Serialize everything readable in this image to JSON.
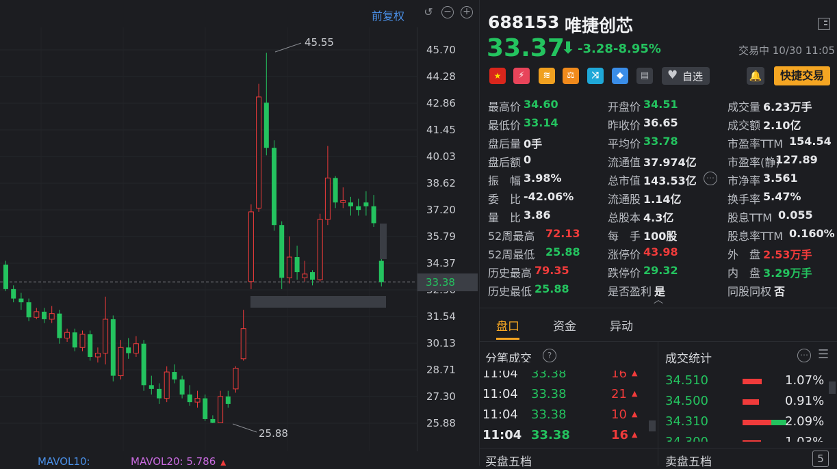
{
  "chart": {
    "adjust_label": "前复权",
    "price_axis": [
      "45.70",
      "44.28",
      "42.86",
      "41.45",
      "40.03",
      "38.62",
      "37.20",
      "35.79",
      "34.37",
      "32.96",
      "31.54",
      "30.13",
      "28.71",
      "27.30",
      "25.88"
    ],
    "current_price_tag": "33.38",
    "high_marker": "45.55",
    "low_marker": "25.88",
    "mavol10_label": "MAVOL10:",
    "mavol20_label": "MAVOL20: 5.786"
  },
  "chart_data": {
    "type": "candlestick",
    "ylim": [
      25.0,
      46.3
    ],
    "candles": [
      {
        "o": 34.3,
        "c": 33.0,
        "h": 34.5,
        "l": 32.9
      },
      {
        "o": 33.0,
        "c": 32.5,
        "h": 33.2,
        "l": 32.3
      },
      {
        "o": 32.5,
        "c": 32.3,
        "h": 32.8,
        "l": 31.9
      },
      {
        "o": 32.3,
        "c": 31.5,
        "h": 32.5,
        "l": 31.3
      },
      {
        "o": 31.5,
        "c": 31.8,
        "h": 32.0,
        "l": 31.4
      },
      {
        "o": 31.8,
        "c": 31.4,
        "h": 32.0,
        "l": 31.2
      },
      {
        "o": 31.4,
        "c": 31.7,
        "h": 32.1,
        "l": 31.2
      },
      {
        "o": 31.7,
        "c": 30.4,
        "h": 31.9,
        "l": 30.1
      },
      {
        "o": 30.4,
        "c": 30.7,
        "h": 30.9,
        "l": 30.2
      },
      {
        "o": 30.7,
        "c": 29.9,
        "h": 30.9,
        "l": 29.7
      },
      {
        "o": 29.9,
        "c": 30.6,
        "h": 30.8,
        "l": 29.7
      },
      {
        "o": 30.6,
        "c": 29.4,
        "h": 30.8,
        "l": 29.2
      },
      {
        "o": 29.4,
        "c": 29.6,
        "h": 29.9,
        "l": 29.1
      },
      {
        "o": 29.6,
        "c": 31.4,
        "h": 32.6,
        "l": 29.0
      },
      {
        "o": 31.4,
        "c": 28.4,
        "h": 31.6,
        "l": 28.1
      },
      {
        "o": 28.4,
        "c": 29.9,
        "h": 30.3,
        "l": 28.2
      },
      {
        "o": 29.9,
        "c": 29.6,
        "h": 30.4,
        "l": 29.3
      },
      {
        "o": 29.6,
        "c": 30.1,
        "h": 30.5,
        "l": 29.4
      },
      {
        "o": 30.1,
        "c": 27.9,
        "h": 30.3,
        "l": 27.6
      },
      {
        "o": 27.9,
        "c": 27.7,
        "h": 28.4,
        "l": 27.4
      },
      {
        "o": 27.7,
        "c": 27.2,
        "h": 28.0,
        "l": 26.9
      },
      {
        "o": 27.2,
        "c": 28.6,
        "h": 28.9,
        "l": 27.0
      },
      {
        "o": 28.6,
        "c": 28.2,
        "h": 29.0,
        "l": 28.0
      },
      {
        "o": 28.2,
        "c": 27.4,
        "h": 28.4,
        "l": 27.2
      },
      {
        "o": 27.4,
        "c": 27.0,
        "h": 27.9,
        "l": 26.8
      },
      {
        "o": 27.0,
        "c": 27.2,
        "h": 27.6,
        "l": 26.7
      },
      {
        "o": 27.2,
        "c": 26.1,
        "h": 27.4,
        "l": 26.0
      },
      {
        "o": 26.1,
        "c": 25.9,
        "h": 26.3,
        "l": 25.88
      },
      {
        "o": 25.9,
        "c": 27.3,
        "h": 27.6,
        "l": 25.88
      },
      {
        "o": 27.3,
        "c": 26.9,
        "h": 27.6,
        "l": 26.7
      },
      {
        "o": 27.7,
        "c": 28.8,
        "h": 28.9,
        "l": 27.5
      },
      {
        "o": 29.3,
        "c": 30.9,
        "h": 31.9,
        "l": 29.2
      },
      {
        "o": 33.4,
        "c": 37.1,
        "h": 37.5,
        "l": 33.0
      },
      {
        "o": 37.3,
        "c": 43.2,
        "h": 43.9,
        "l": 37.1
      },
      {
        "o": 42.9,
        "c": 40.5,
        "h": 45.55,
        "l": 40.1
      },
      {
        "o": 40.5,
        "c": 36.4,
        "h": 40.9,
        "l": 36.1
      },
      {
        "o": 36.4,
        "c": 33.6,
        "h": 36.6,
        "l": 33.0
      },
      {
        "o": 33.6,
        "c": 34.7,
        "h": 35.8,
        "l": 33.3
      },
      {
        "o": 34.7,
        "c": 33.9,
        "h": 35.3,
        "l": 33.5
      },
      {
        "o": 33.6,
        "c": 33.8,
        "h": 34.5,
        "l": 33.4
      },
      {
        "o": 33.9,
        "c": 33.5,
        "h": 34.0,
        "l": 33.2
      },
      {
        "o": 33.5,
        "c": 36.7,
        "h": 37.0,
        "l": 33.4
      },
      {
        "o": 36.7,
        "c": 38.9,
        "h": 40.6,
        "l": 36.4
      },
      {
        "o": 38.9,
        "c": 37.6,
        "h": 39.0,
        "l": 37.3
      },
      {
        "o": 37.6,
        "c": 37.7,
        "h": 38.4,
        "l": 37.3
      },
      {
        "o": 37.6,
        "c": 37.4,
        "h": 37.9,
        "l": 36.9
      },
      {
        "o": 37.4,
        "c": 37.2,
        "h": 37.8,
        "l": 36.9
      },
      {
        "o": 37.6,
        "c": 37.4,
        "h": 38.2,
        "l": 36.9
      },
      {
        "o": 37.4,
        "c": 36.5,
        "h": 38.0,
        "l": 36.3
      },
      {
        "o": 34.5,
        "c": 33.37,
        "h": 34.6,
        "l": 33.14
      }
    ]
  },
  "quote": {
    "code": "688153",
    "name": "唯捷创芯",
    "price": "33.37",
    "change": "-3.28",
    "change_pct": "-8.95%",
    "status": "交易中 10/30 11:05",
    "watch_label": "自选",
    "quick_trade": "快捷交易"
  },
  "stats": [
    [
      {
        "l": "最高价",
        "v": "34.60",
        "c": "green"
      },
      {
        "l": "开盘价",
        "v": "34.51",
        "c": "green"
      },
      {
        "l": "成交量",
        "v": "6.23万手",
        "c": "white"
      }
    ],
    [
      {
        "l": "最低价",
        "v": "33.14",
        "c": "green"
      },
      {
        "l": "昨收价",
        "v": "36.65",
        "c": "white"
      },
      {
        "l": "成交额",
        "v": "2.10亿",
        "c": "white"
      }
    ],
    [
      {
        "l": "盘后量",
        "v": "0手",
        "c": "white"
      },
      {
        "l": "平均价",
        "v": "33.78",
        "c": "green"
      },
      {
        "l": "市盈率TTM",
        "v": "154.54",
        "c": "white"
      }
    ],
    [
      {
        "l": "盘后额",
        "v": "0",
        "c": "white"
      },
      {
        "l": "流通值",
        "v": "37.974亿",
        "c": "white"
      },
      {
        "l": "市盈率(静)",
        "v": "127.89",
        "c": "white"
      }
    ],
    [
      {
        "l": "振　幅",
        "v": "3.98%",
        "c": "white"
      },
      {
        "l": "总市值",
        "v": "143.53亿",
        "c": "white"
      },
      {
        "l": "市净率",
        "v": "3.561",
        "c": "white"
      }
    ],
    [
      {
        "l": "委　比",
        "v": "-42.06%",
        "c": "white"
      },
      {
        "l": "流通股",
        "v": "1.14亿",
        "c": "white"
      },
      {
        "l": "换手率",
        "v": "5.47%",
        "c": "white"
      }
    ],
    [
      {
        "l": "量　比",
        "v": "3.86",
        "c": "white"
      },
      {
        "l": "总股本",
        "v": "4.3亿",
        "c": "white"
      },
      {
        "l": "股息TTM",
        "v": "0.055",
        "c": "white"
      }
    ],
    [
      {
        "l": "52周最高",
        "v": "72.13",
        "c": "red"
      },
      {
        "l": "每　手",
        "v": "100股",
        "c": "white"
      },
      {
        "l": "股息率TTM",
        "v": "0.160%",
        "c": "white"
      }
    ],
    [
      {
        "l": "52周最低",
        "v": "25.88",
        "c": "green"
      },
      {
        "l": "涨停价",
        "v": "43.98",
        "c": "red"
      },
      {
        "l": "外　盘",
        "v": "2.53万手",
        "c": "red"
      }
    ],
    [
      {
        "l": "历史最高",
        "v": "79.35",
        "c": "red"
      },
      {
        "l": "跌停价",
        "v": "29.32",
        "c": "green"
      },
      {
        "l": "内　盘",
        "v": "3.29万手",
        "c": "green"
      }
    ],
    [
      {
        "l": "历史最低",
        "v": "25.88",
        "c": "green"
      },
      {
        "l": "是否盈利",
        "v": "是",
        "c": "white"
      },
      {
        "l": "同股同权",
        "v": "否",
        "c": "white"
      }
    ]
  ],
  "tabs": [
    "盘口",
    "资金",
    "异动"
  ],
  "ticks_title": "分笔成交",
  "ticks": [
    {
      "time": "11:04",
      "price": "33.38",
      "vol": "16"
    },
    {
      "time": "11:04",
      "price": "33.38",
      "vol": "21"
    },
    {
      "time": "11:04",
      "price": "33.38",
      "vol": "10"
    },
    {
      "time": "11:04",
      "price": "33.38",
      "vol": "16"
    }
  ],
  "deal_stats_title": "成交统计",
  "deal_stats": [
    {
      "price": "34.510",
      "pct": "1.07%",
      "red": 0.28,
      "green": 0
    },
    {
      "price": "34.500",
      "pct": "0.91%",
      "red": 0.24,
      "green": 0
    },
    {
      "price": "34.310",
      "pct": "2.09%",
      "red": 0.42,
      "green": 0.22
    },
    {
      "price": "34.300",
      "pct": "1.03%",
      "red": 0.27,
      "green": 0
    }
  ],
  "bottom": {
    "buy5": "买盘五档",
    "sell5": "卖盘五档",
    "s_badge": "5"
  }
}
